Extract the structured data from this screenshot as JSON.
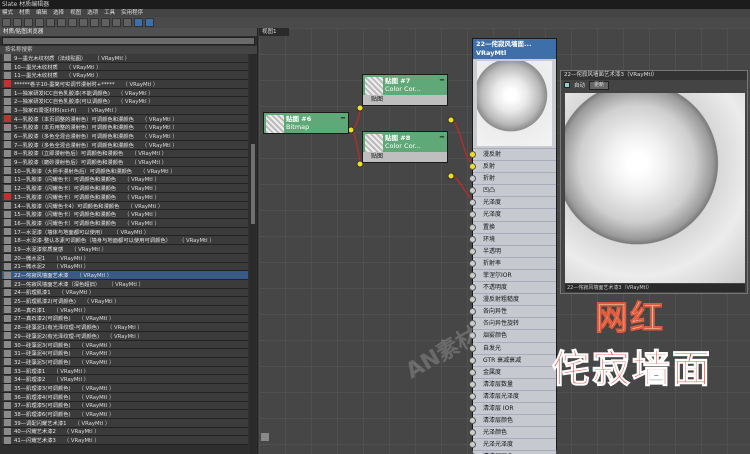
{
  "window": {
    "title": "Slate 材质编辑器"
  },
  "menu": [
    "模式",
    "材质",
    "编辑",
    "选择",
    "视图",
    "选项",
    "工具",
    "实用程序"
  ],
  "browser": {
    "title": "材质/贴图浏览器",
    "search_label": "按名称搜索",
    "items": [
      {
        "name": "9—墨光木纹材质（法线贴图）",
        "type": "（ VRayMtl ）",
        "swatch": "gray",
        "selected": false
      },
      {
        "name": "10—墨光木纹材质",
        "type": "（ VRayMtl ）",
        "swatch": "gray",
        "selected": false
      },
      {
        "name": "11—墨光木纹材质",
        "type": "（ VRayMtl ）",
        "swatch": "gray",
        "selected": false
      },
      {
        "name": "******卷子10-墨简可实调节漫射时+*****",
        "type": "（ VRayMtl ）",
        "swatch": "red",
        "selected": false
      },
      {
        "name": "1—独家研发ICC自色乳胶漆(不能调颜色)",
        "type": "（ VRayMtl ）",
        "swatch": "gray",
        "selected": false
      },
      {
        "name": "2—独家研发ICC自色乳胶漆(可以调颜色)",
        "type": "（ VRayMtl ）",
        "swatch": "gray",
        "selected": false
      },
      {
        "name": "3—独家石膏抠材料(sci-fi)",
        "type": "（ VRayMtl ）",
        "swatch": "gray",
        "selected": false
      },
      {
        "name": "4—乳胶漆（本页调整的漫射色）可调颜色和漫颜色",
        "type": "（ VRayMtl ）",
        "swatch": "red",
        "selected": false
      },
      {
        "name": "5—乳胶漆（本页用整的漫射色）可调颜色和漫颜色",
        "type": "（ VRayMtl ）",
        "swatch": "gray",
        "selected": false
      },
      {
        "name": "6—乳胶漆（多色全混合漫射色）可调颜色和漫颜色",
        "type": "（ VRayMtl ）",
        "swatch": "gray",
        "selected": false
      },
      {
        "name": "7—乳胶漆（多色全混合漫射色）可调颜色和漫颜色",
        "type": "（ VRayMtl ）",
        "swatch": "gray",
        "selected": false
      },
      {
        "name": "8—乳胶漆（立即漫射色后）可调颜色和漫颜色",
        "type": "（ VRayMtl ）",
        "swatch": "gray",
        "selected": false
      },
      {
        "name": "9—乳胶漆（磨砂漫射色后）可调颜色和漫颜色",
        "type": "（ VRayMtl ）",
        "swatch": "gray",
        "selected": false
      },
      {
        "name": "10—乳胶漆（大师手漫射色后）可调颜色和漫颜色",
        "type": "（ VRayMtl ）",
        "swatch": "gray",
        "selected": false
      },
      {
        "name": "11—乳胶漆（闪耀色卡）可调颜色和漫颜色",
        "type": "（ VRayMtl ）",
        "swatch": "gray",
        "selected": false
      },
      {
        "name": "12—乳胶漆（闪耀色卡）可调颜色和漫颜色",
        "type": "（ VRayMtl ）",
        "swatch": "gray",
        "selected": false
      },
      {
        "name": "13—乳胶漆（闪耀色卡）可调颜色和漫颜色",
        "type": "（ VRayMtl ）",
        "swatch": "red",
        "selected": false
      },
      {
        "name": "14—乳胶漆（闪耀色卡4）可调颜色和漫颜色",
        "type": "（ VRayMtl ）",
        "swatch": "gray",
        "selected": false
      },
      {
        "name": "15—乳胶漆（闪耀色卡）可调颜色和漫颜色",
        "type": "（ VRayMtl ）",
        "swatch": "gray",
        "selected": false
      },
      {
        "name": "16—乳胶漆（闪耀色卡）可调颜色和漫颜色",
        "type": "（ VRayMtl ）",
        "swatch": "gray",
        "selected": false
      },
      {
        "name": "17—水泥漆（墙体与地面都可以使用）",
        "type": "（ VRayMtl ）",
        "swatch": "gray",
        "selected": false
      },
      {
        "name": "18—水泥漆-整认本素可调颜色（墙身与地面都可以使用可调颜色）",
        "type": "（ VRayMtl ）",
        "swatch": "gray",
        "selected": false
      },
      {
        "name": "19—水泥漆浆质度感",
        "type": "（ VRayMtl ）",
        "swatch": "gray",
        "selected": false
      },
      {
        "name": "20—微水泥1",
        "type": "（ VRayMtl ）",
        "swatch": "gray",
        "selected": false
      },
      {
        "name": "21—微水泥2",
        "type": "（ VRayMtl ）",
        "swatch": "gray",
        "selected": false
      },
      {
        "name": "22—侘寂风墙面艺术漆",
        "type": "（ VRayMtl ）",
        "swatch": "gray",
        "selected": true
      },
      {
        "name": "23—侘寂风墙面艺术漆（深色超旧）",
        "type": "（ VRayMtl ）",
        "swatch": "gray",
        "selected": false
      },
      {
        "name": "24—肌理肌漆1",
        "type": "（ VRayMtl ）",
        "swatch": "gray",
        "selected": false
      },
      {
        "name": "25—肌理肌漆2(可调颜色)",
        "type": "（ VRayMtl ）",
        "swatch": "gray",
        "selected": false
      },
      {
        "name": "26—真石漆1",
        "type": "（ VRayMtl ）",
        "swatch": "gray",
        "selected": false
      },
      {
        "name": "27—真石漆2(可调颜色)",
        "type": "（ VRayMtl ）",
        "swatch": "gray",
        "selected": false
      },
      {
        "name": "28—硅藻泥1(有光泽纹理-可调颜色)",
        "type": "（ VRayMtl ）",
        "swatch": "gray",
        "selected": false
      },
      {
        "name": "29—硅藻泥2(有光泽纹理-可调颜色)",
        "type": "（ VRayMtl ）",
        "swatch": "gray",
        "selected": false
      },
      {
        "name": "30—硅藻泥3(可调颜色)",
        "type": "（ VRayMtl ）",
        "swatch": "gray",
        "selected": false
      },
      {
        "name": "31—硅藻泥4(可调颜色)",
        "type": "（ VRayMtl ）",
        "swatch": "gray",
        "selected": false
      },
      {
        "name": "32—硅藻泥5(可调颜色)",
        "type": "（ VRayMtl ）",
        "swatch": "gray",
        "selected": false
      },
      {
        "name": "33—肌理漆1",
        "type": "（ VRayMtl ）",
        "swatch": "gray",
        "selected": false
      },
      {
        "name": "34—肌理漆2",
        "type": "（ VRayMtl ）",
        "swatch": "gray",
        "selected": false
      },
      {
        "name": "35—肌理漆3(可调颜色)",
        "type": "（ VRayMtl ）",
        "swatch": "gray",
        "selected": false
      },
      {
        "name": "36—肌理漆4(可调颜色)",
        "type": "（ VRayMtl ）",
        "swatch": "gray",
        "selected": false
      },
      {
        "name": "37—肌理漆5(可调颜色)",
        "type": "（ VRayMtl ）",
        "swatch": "gray",
        "selected": false
      },
      {
        "name": "38—肌理漆6(可调颜色)",
        "type": "（ VRayMtl ）",
        "swatch": "gray",
        "selected": false
      },
      {
        "name": "39—调配闪耀艺术漆1",
        "type": "（ VRayMtl ）",
        "swatch": "gray",
        "selected": false
      },
      {
        "name": "40—闪耀艺术漆2",
        "type": "（ VRayMtl ）",
        "swatch": "gray",
        "selected": false
      },
      {
        "name": "41—闪耀艺术漆3",
        "type": "（ VRayMtl ）",
        "swatch": "gray",
        "selected": false
      }
    ]
  },
  "view": {
    "tab_label": "视图1",
    "nodes": [
      {
        "title": "贴图 #6",
        "subtitle": "Bitmap"
      },
      {
        "title": "贴图 #7",
        "subtitle": "Color Cor...",
        "slot": "贴图"
      },
      {
        "title": "贴图 #8",
        "subtitle": "Color Cor...",
        "slot": "贴图"
      }
    ]
  },
  "vray_node": {
    "title": "22—侘寂风墙面...",
    "subtitle": "VRayMtl",
    "slots": [
      "漫反射",
      "反射",
      "折射",
      "凹凸",
      "光泽度",
      "光泽度",
      "置换",
      "环境",
      "半透明",
      "折射率",
      "菲涅尔IOR",
      "不透明度",
      "漫反射粗糙度",
      "各向异性",
      "各向异性旋转",
      "烟雾颜色",
      "自发光",
      "GTR 衰减衰减",
      "金属度",
      "清漆层数量",
      "清漆层光泽度",
      "清漆层 IOR",
      "清漆层颜色",
      "光泽颜色",
      "光泽光泽度",
      "清漆层凹凸"
    ]
  },
  "preview_window": {
    "title": "22—侘寂风墙面艺术漆3（VRayMtl）",
    "auto_label": "自动",
    "update_label": "更新",
    "footer": "22—侘寂风墙面艺术漆3（VRayMtl）"
  },
  "overlay": {
    "line1": "网红",
    "line2": "侘寂墙面"
  },
  "watermark": {
    "text": "AN素材库"
  },
  "colors": {
    "node_green": "#5fa878",
    "node_blue": "#3f6fa8",
    "wire_red": "#c62828",
    "socket_yellow": "#f0e020",
    "selection": "#3a5a86"
  }
}
